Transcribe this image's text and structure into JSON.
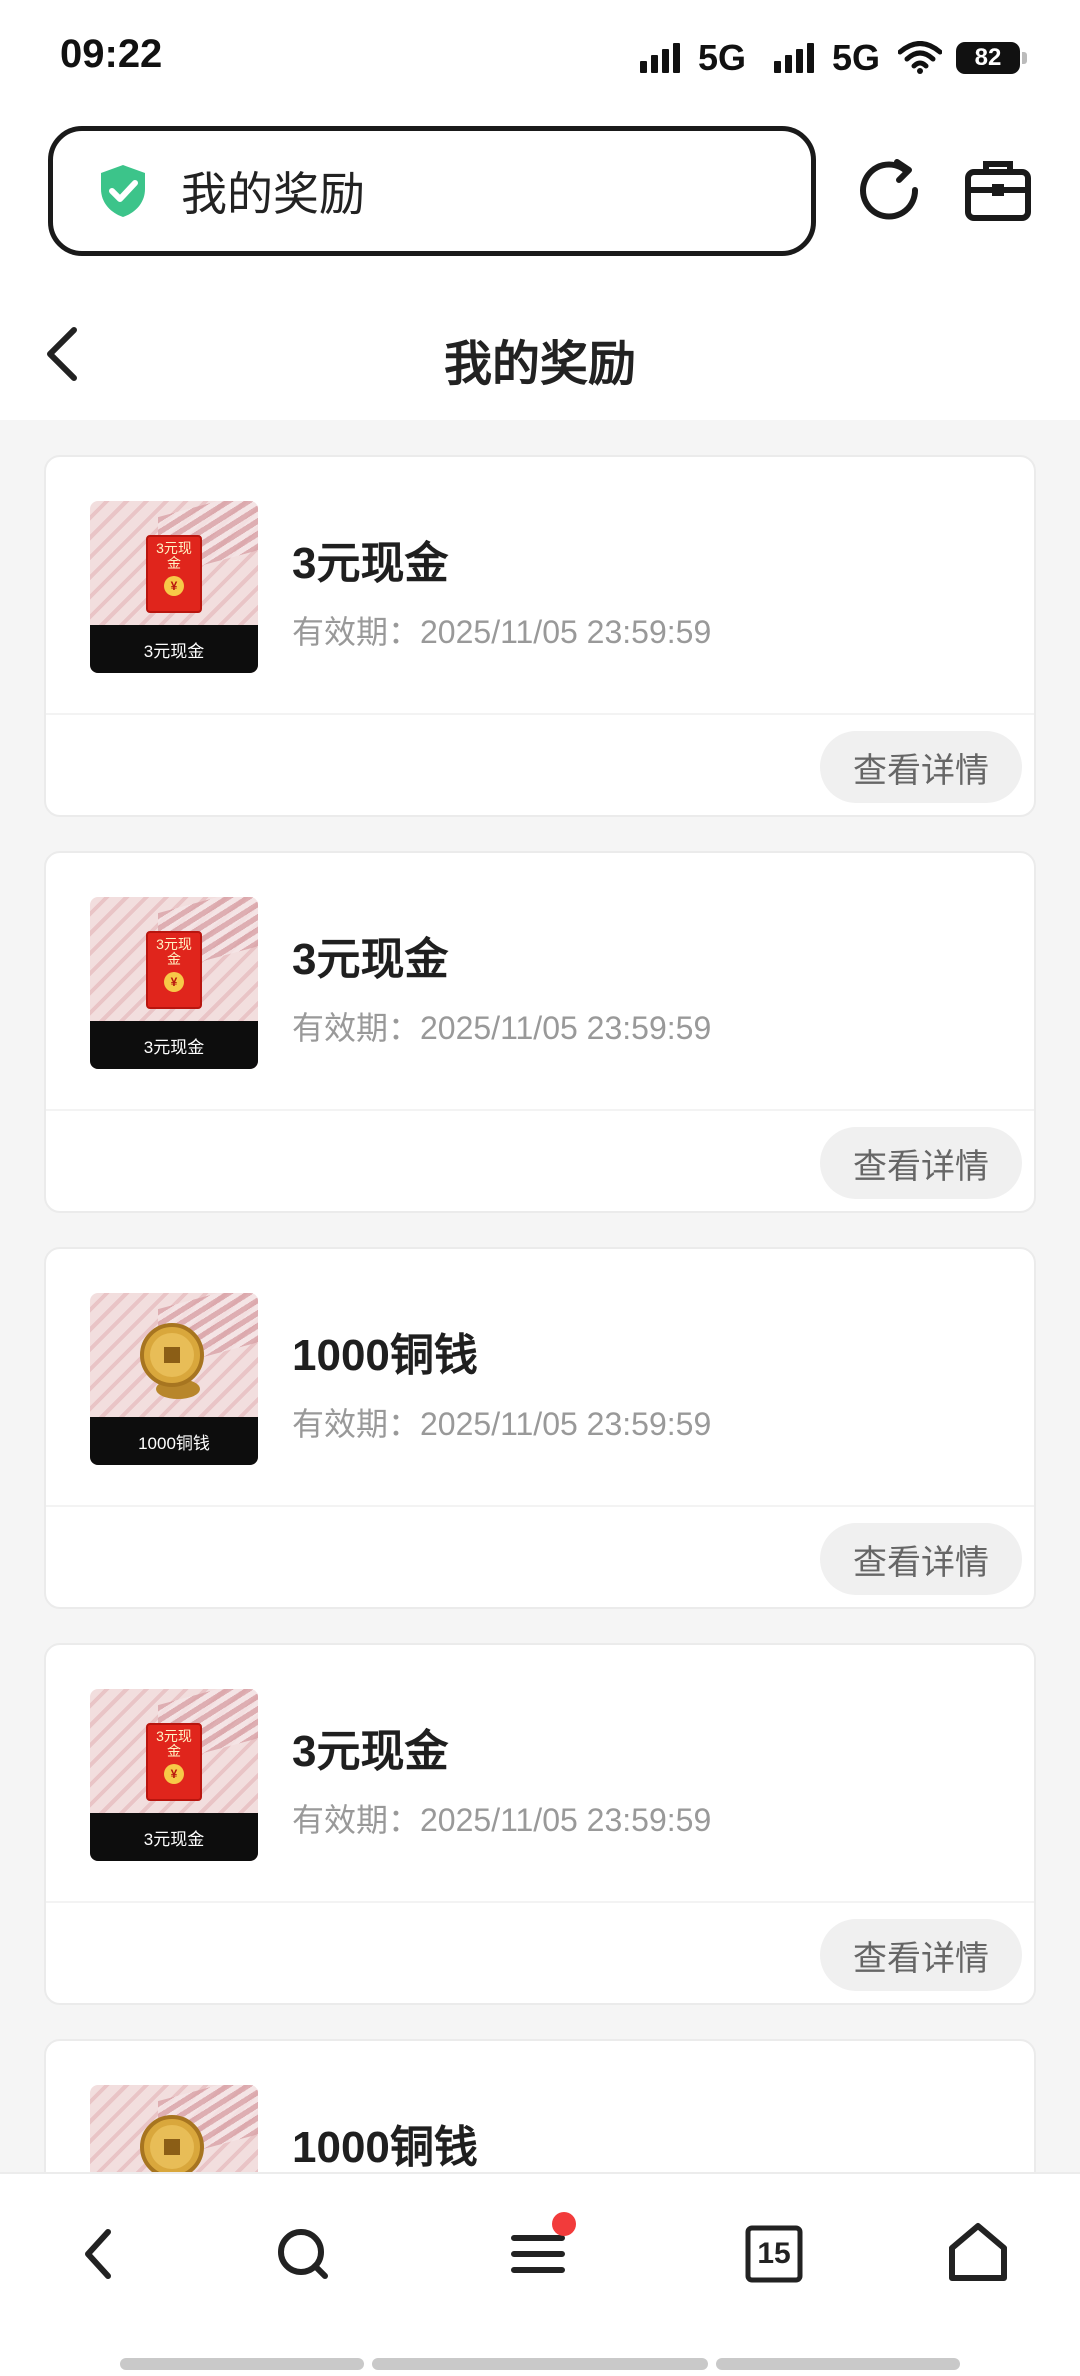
{
  "status_bar": {
    "time": "09:22",
    "network_1": "5G",
    "network_2": "5G",
    "battery": "82"
  },
  "browser": {
    "url_title": "我的奖励",
    "security_icon": "shield-check-icon",
    "accent_color": "#3cc48a"
  },
  "header": {
    "title": "我的奖励"
  },
  "rewards": [
    {
      "title": "3元现金",
      "expiry": "有效期：2025/11/05 23:59:59",
      "thumb_label": "3元现金",
      "thumb_badge": "3元现金",
      "kind": "cash",
      "button": "查看详情"
    },
    {
      "title": "3元现金",
      "expiry": "有效期：2025/11/05 23:59:59",
      "thumb_label": "3元现金",
      "thumb_badge": "3元现金",
      "kind": "cash",
      "button": "查看详情"
    },
    {
      "title": "1000铜钱",
      "expiry": "有效期：2025/11/05 23:59:59",
      "thumb_label": "1000铜钱",
      "kind": "coin",
      "button": "查看详情"
    },
    {
      "title": "3元现金",
      "expiry": "有效期：2025/11/05 23:59:59",
      "thumb_label": "3元现金",
      "thumb_badge": "3元现金",
      "kind": "cash",
      "button": "查看详情"
    },
    {
      "title": "1000铜钱",
      "kind": "coin"
    }
  ],
  "bottom_nav": {
    "tab_count": "15",
    "items": [
      "back-icon",
      "search-icon",
      "menu-icon",
      "tabs-icon",
      "home-icon"
    ]
  }
}
